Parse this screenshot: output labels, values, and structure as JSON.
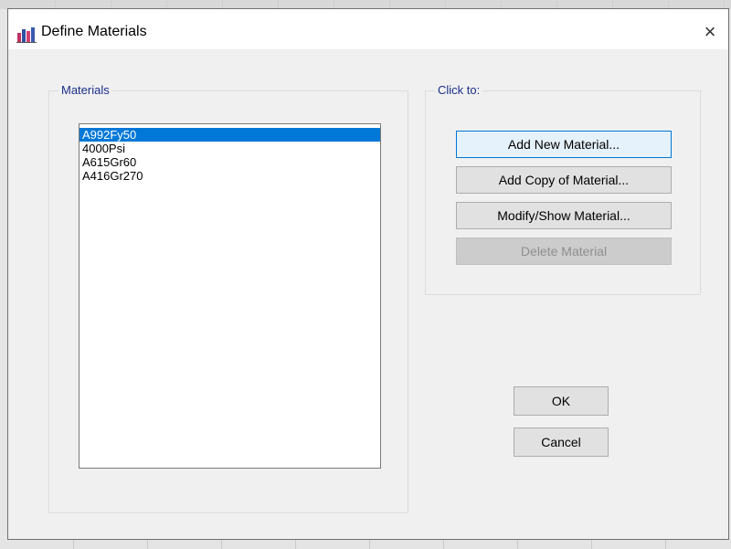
{
  "window": {
    "title": "Define Materials",
    "close_glyph": "×",
    "icon": "app-icon"
  },
  "materials_group": {
    "label": "Materials",
    "items": [
      {
        "label": "A992Fy50",
        "selected": true
      },
      {
        "label": "4000Psi",
        "selected": false
      },
      {
        "label": "A615Gr60",
        "selected": false
      },
      {
        "label": "A416Gr270",
        "selected": false
      }
    ]
  },
  "click_to_group": {
    "label": "Click to:",
    "add_new": "Add New Material...",
    "add_copy": "Add Copy of Material...",
    "modify_show": "Modify/Show Material...",
    "delete": "Delete Material"
  },
  "buttons": {
    "ok": "OK",
    "cancel": "Cancel"
  },
  "colors": {
    "selection": "#0078d7",
    "group_label": "#1a2d88",
    "disabled_text": "#8f8f8f"
  }
}
